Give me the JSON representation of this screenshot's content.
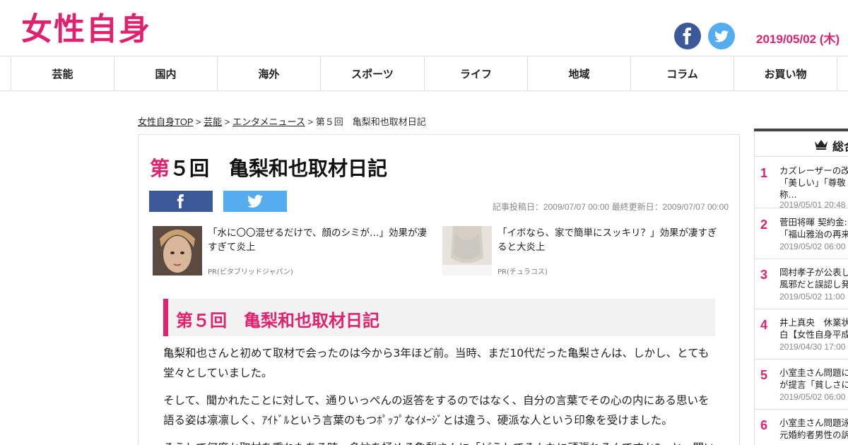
{
  "header": {
    "logo_text": "女性自身",
    "date": "2019/05/02 (木)"
  },
  "nav": {
    "items": [
      {
        "label": "芸能"
      },
      {
        "label": "国内"
      },
      {
        "label": "海外"
      },
      {
        "label": "スポーツ"
      },
      {
        "label": "ライフ"
      },
      {
        "label": "地域"
      },
      {
        "label": "コラム"
      },
      {
        "label": "お買い物"
      }
    ]
  },
  "breadcrumb": {
    "items": [
      "女性自身TOP",
      "芸能",
      "エンタメニュース"
    ],
    "separator": " > ",
    "current": "第５回　亀梨和也取材日記"
  },
  "article": {
    "title_accent": "第",
    "title_rest": "５回　亀梨和也取材日記",
    "meta": "記事投稿日：2009/07/07 00:00 最終更新日：2009/07/07 00:00",
    "pr": [
      {
        "text": "「水に〇〇混ぜるだけで、顔のシミが…」効果が凄すぎて炎上",
        "source": "PR(ビタブリッドジャパン)"
      },
      {
        "text": "「イボなら、家で簡単にスッキリ？」効果が凄すぎると大炎上",
        "source": "PR(チュラコス)"
      }
    ],
    "section_title": "第５回　亀梨和也取材日記",
    "paragraphs": [
      "亀梨和也さんと初めて取材で会ったのは今から3年ほど前。当時、まだ10代だった亀梨さんは、しかし、とても堂々としていました。",
      "そして、聞かれたことに対して、通りいっぺんの返答をするのではなく、自分の言葉でその心の内にある思いを語る姿は凛凛しく、ｱｲﾄﾞﾙという言葉のもつﾎﾟｯﾌﾟなｲﾒｰｼﾞとは違う、硬派な人という印象を受けました。",
      "そうして何度か取材を重ねたある時、多忙を極める亀梨さんに「どうしてそんなに頑張れるんですか?」と、聞い"
    ]
  },
  "sidebar": {
    "header": "総合",
    "ranking": [
      {
        "num": "1",
        "lines": [
          "カズレーザーの改",
          "「美しい」「尊敬",
          "称..."
        ],
        "date": "2019/05/01 20:48"
      },
      {
        "num": "2",
        "lines": [
          "菅田将暉 契約金:",
          "「福山雅治の再来"
        ],
        "date": "2019/05/02 06:00"
      },
      {
        "num": "3",
        "lines": [
          "岡村孝子が公表し",
          "風邪だと誤認し発"
        ],
        "date": "2019/05/02 11:00"
      },
      {
        "num": "4",
        "lines": [
          "井上真央　休業状",
          "白【女性自身平成"
        ],
        "date": "2019/04/30 17:00"
      },
      {
        "num": "5",
        "lines": [
          "小室圭さん問題に",
          "が提言「貧しさに"
        ],
        "date": "2019/05/02 06:00"
      },
      {
        "num": "6",
        "lines": [
          "小室圭さん問題泳",
          "元婚約者男性の訴"
        ],
        "date": ""
      }
    ]
  }
}
